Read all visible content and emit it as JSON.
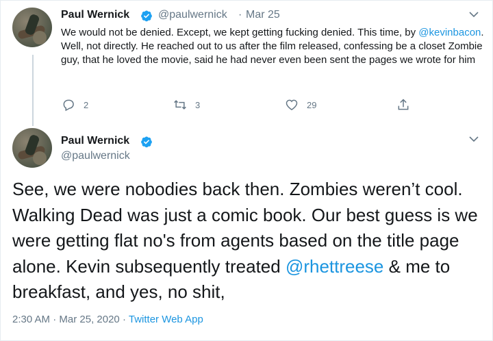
{
  "tweet1": {
    "author_name": "Paul Wernick",
    "handle": "@paulwernick",
    "separator": "·",
    "date": "Mar 25",
    "text_before": "We would not be denied.  Except, we kept getting fucking denied.  This time, by ",
    "mention": "@kevinbacon",
    "text_after": ".  Well, not directly.  He reached out to us after the film released, confessing be a closet Zombie guy, that he loved the movie, said he had never even been sent the pages we wrote for him",
    "replies": "2",
    "retweets": "3",
    "likes": "29"
  },
  "tweet2": {
    "author_name": "Paul Wernick",
    "handle": "@paulwernick",
    "text_before": "See, we were nobodies back then.  Zombies weren’t cool. Walking Dead was just a comic book.  Our best guess is we were getting flat no's from agents based on the title page alone.  Kevin subsequently treated ",
    "mention": "@rhettreese",
    "text_after": " & me to breakfast, and yes, no shit,",
    "time": "2:30 AM",
    "separator": "·",
    "date": "Mar 25, 2020",
    "source": "Twitter Web App"
  },
  "icons": {
    "verified": "verified-badge-icon",
    "caret": "chevron-down-icon",
    "reply": "reply-icon",
    "retweet": "retweet-icon",
    "like": "heart-icon",
    "share": "share-icon"
  },
  "colors": {
    "link": "#1b95e0",
    "verified": "#1da1f2",
    "secondary_text": "#657786",
    "thread_line": "#ccd6dd"
  }
}
